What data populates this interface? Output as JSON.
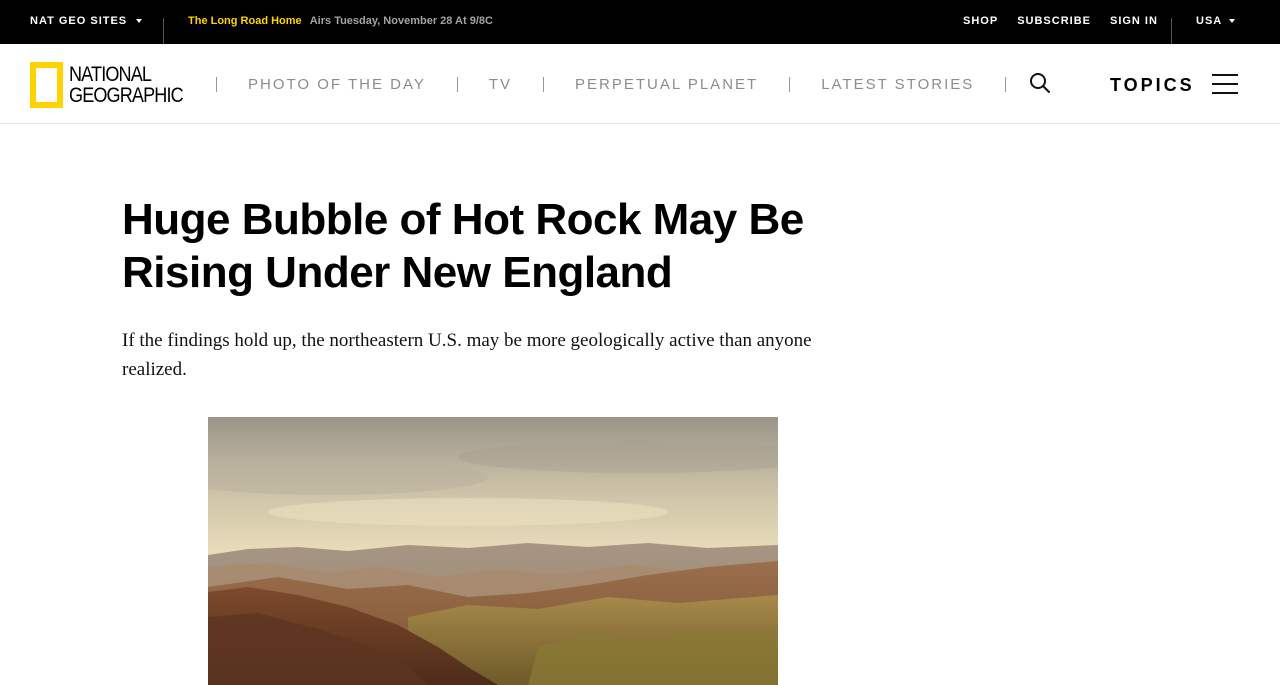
{
  "topbar": {
    "sites_label": "NAT GEO SITES",
    "promo_title": "The Long Road Home",
    "promo_subtitle": "Airs Tuesday, November 28 At 9/8C",
    "links": [
      "SHOP",
      "SUBSCRIBE",
      "SIGN IN"
    ],
    "region": "USA"
  },
  "brand": {
    "logo_line1": "NATIONAL",
    "logo_line2": "GEOGRAPHIC",
    "accent_color": "#ffd200"
  },
  "nav": {
    "items": [
      "PHOTO OF THE DAY",
      "TV",
      "PERPETUAL PLANET",
      "LATEST STORIES"
    ],
    "search_icon": "search-icon",
    "topics_label": "TOPICS",
    "menu_icon": "hamburger-menu-icon"
  },
  "article": {
    "headline": "Huge Bubble of Hot Rock May Be Rising Under New England",
    "dek": "If the findings hold up, the northeastern U.S. may be more geologically active than anyone realized."
  }
}
